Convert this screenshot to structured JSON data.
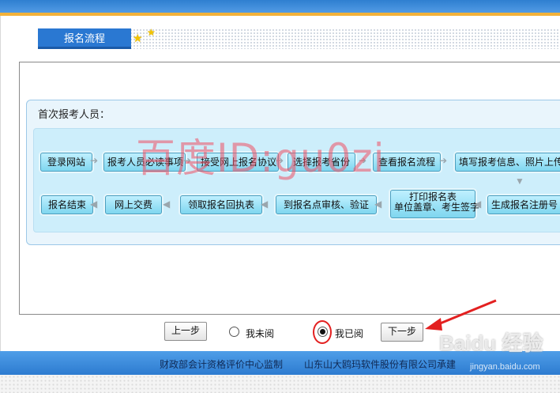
{
  "header": {
    "tab_title": "报名流程"
  },
  "flow": {
    "section_title": "首次报考人员：",
    "row1": [
      "登录网站",
      "报考人员必读事项",
      "接受网上报名协议",
      "选择报考省份",
      "查看报名流程",
      "填写报考信息、照片上传"
    ],
    "row2": [
      "生成报名注册号",
      "打印报名表",
      "到报名点审核、验证",
      "领取报名回执表",
      "网上交费",
      "报名结束"
    ],
    "row2_sub": "单位盖章、考生签字"
  },
  "watermark": "百度ID:gu0zi",
  "controls": {
    "prev_label": "上一步",
    "not_read_label": "我未阅",
    "read_label": "我已阅",
    "next_label": "下一步",
    "selected": "read"
  },
  "footer": {
    "supervisor": "财政部会计资格评价中心监制",
    "builder": "山东山大鸥玛软件股份有限公司承建"
  },
  "overlay": {
    "brand": "Baidu 经验",
    "url": "jingyan.baidu.com"
  },
  "colors": {
    "accent": "#2a78d2",
    "annotation": "#e32020"
  }
}
